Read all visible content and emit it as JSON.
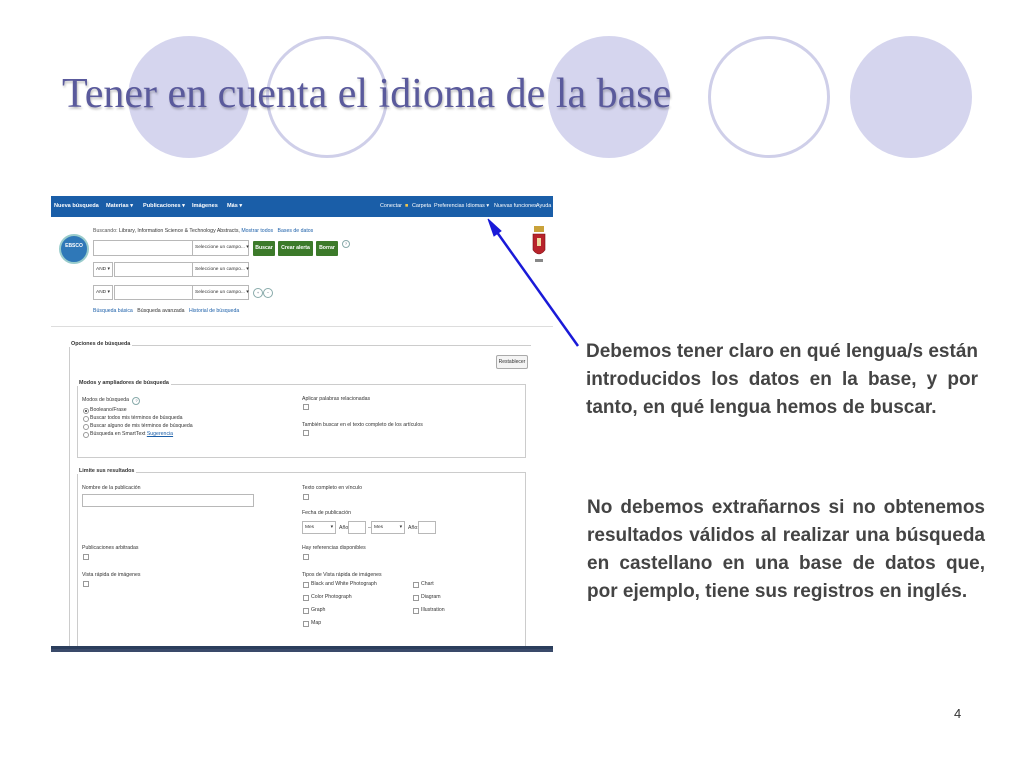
{
  "slide": {
    "title": "Tener en cuenta el idioma de la base",
    "paragraph1": "Debemos tener claro en qué lengua/s están introducidos los datos en la base, y por tanto, en qué lengua hemos de buscar.",
    "paragraph2": "No debemos extrañarnos si no obtenemos resultados válidos al realizar una búsqueda en castellano en una base de datos que, por ejemplo, tiene sus registros en inglés.",
    "page_number": "4",
    "arrow_color": "#1a1ad8",
    "circle_color": "#d5d5ee"
  },
  "ebsco": {
    "topnav": {
      "left": [
        "Nueva búsqueda",
        "Materias ▾",
        "Publicaciones ▾",
        "Imágenes",
        "Más ▾"
      ],
      "right": [
        "Conectar",
        "Carpeta",
        "Preferencias",
        "Idiomas ▾",
        "Nuevas funciones",
        "Ayuda"
      ]
    },
    "logo": "EBSCO",
    "searching_label": "Buscando:",
    "searching_db": "Library, Information Science & Technology Abstracts,",
    "show_all": "Mostrar todos",
    "databases": "Bases de datos",
    "field_select": "Seleccione un campo... ▾",
    "bool_and": "AND ▾",
    "buttons": {
      "search": "Buscar",
      "alert": "Crear alerta",
      "clear": "Borrar"
    },
    "help": "?",
    "links": [
      "Búsqueda básica",
      "Búsqueda avanzada",
      "Historial de búsqueda"
    ],
    "options_title": "Opciones de búsqueda",
    "reset": "Restablecer",
    "modes_title": "Modos y ampliadores de búsqueda",
    "modes_label": "Modos de búsqueda",
    "modes": [
      "Booleano/Frase",
      "Buscar todos mis términos de búsqueda",
      "Buscar alguno de mis términos de búsqueda",
      "Búsqueda en SmartText"
    ],
    "smarttext_hint": "Sugerencia",
    "apply_related": "Aplicar palabras relacionadas",
    "also_fulltext": "También buscar en el texto completo de los artículos",
    "limit_title": "Limite sus resultados",
    "pub_name": "Nombre de la publicación",
    "fulltext_link": "Texto completo en vínculo",
    "pub_date": "Fecha de publicación",
    "month": "Mes",
    "year": "Año:",
    "date_sep": "–",
    "refereed": "Publicaciones arbitradas",
    "refs_available": "Hay referencias disponibles",
    "image_quick": "Vista rápida de imágenes",
    "image_types_label": "Tipos de Vista rápida de imágenes",
    "image_types_col1": [
      "Black and White Photograph",
      "Color Photograph",
      "Graph",
      "Map"
    ],
    "image_types_col2": [
      "Chart",
      "Diagram",
      "Illustration"
    ]
  }
}
